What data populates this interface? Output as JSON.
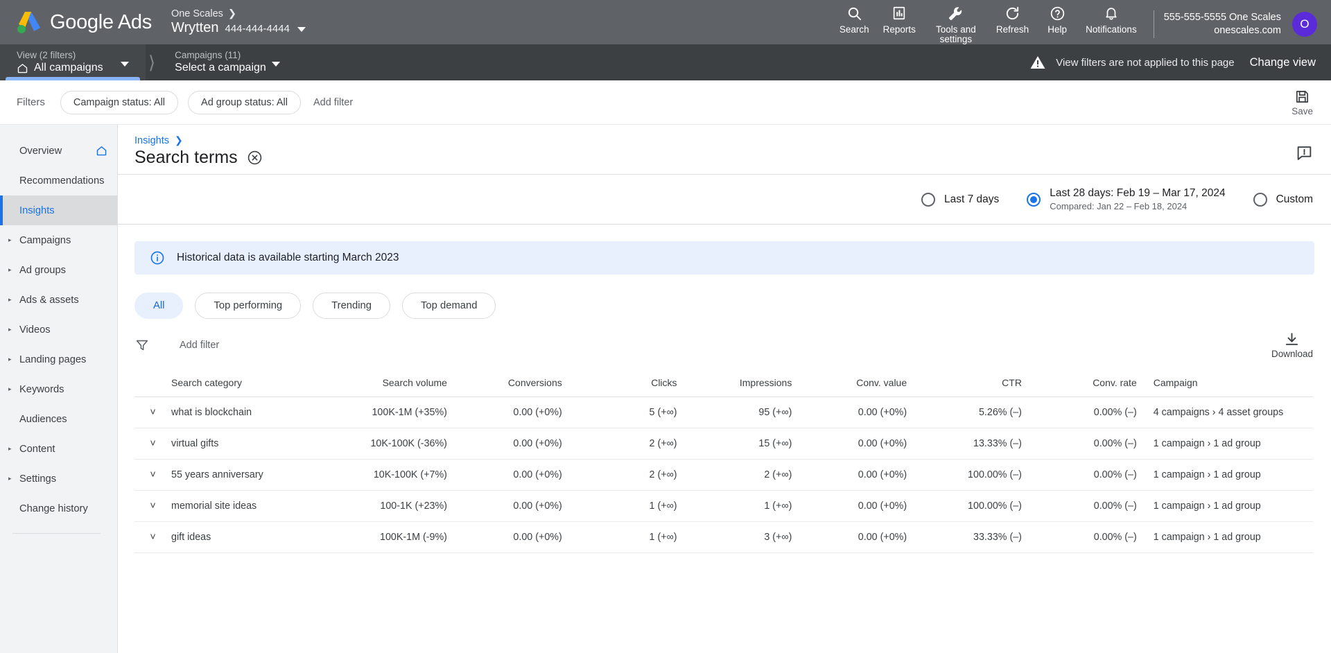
{
  "header": {
    "brand": "Google Ads",
    "manager_account": "One Scales",
    "account_name": "Wrytten",
    "account_id": "444-444-4444",
    "actions": [
      {
        "label": "Search",
        "icon": "search-icon"
      },
      {
        "label": "Reports",
        "icon": "reports-icon"
      },
      {
        "label": "Tools and settings",
        "icon": "wrench-icon"
      },
      {
        "label": "Refresh",
        "icon": "refresh-icon"
      },
      {
        "label": "Help",
        "icon": "help-icon"
      },
      {
        "label": "Notifications",
        "icon": "bell-icon"
      }
    ],
    "account_phone": "555-555-5555 One Scales",
    "account_domain": "onescales.com",
    "avatar_initial": "O"
  },
  "viewbar": {
    "view_caption": "View (2 filters)",
    "view_value": "All campaigns",
    "campaigns_caption": "Campaigns (11)",
    "campaigns_value": "Select a campaign",
    "warning": "View filters are not applied to this page",
    "change_view": "Change view"
  },
  "filterbar": {
    "label": "Filters",
    "chips": [
      "Campaign status: All",
      "Ad group status: All"
    ],
    "add_filter": "Add filter",
    "save_label": "Save"
  },
  "sidebar": {
    "items": [
      {
        "label": "Overview",
        "expandable": false,
        "selected": false,
        "trailing_icon": "home-icon"
      },
      {
        "label": "Recommendations",
        "expandable": false,
        "selected": false
      },
      {
        "label": "Insights",
        "expandable": false,
        "selected": true
      },
      {
        "label": "Campaigns",
        "expandable": true,
        "selected": false
      },
      {
        "label": "Ad groups",
        "expandable": true,
        "selected": false
      },
      {
        "label": "Ads & assets",
        "expandable": true,
        "selected": false
      },
      {
        "label": "Videos",
        "expandable": true,
        "selected": false
      },
      {
        "label": "Landing pages",
        "expandable": true,
        "selected": false
      },
      {
        "label": "Keywords",
        "expandable": true,
        "selected": false
      },
      {
        "label": "Audiences",
        "expandable": false,
        "selected": false
      },
      {
        "label": "Content",
        "expandable": true,
        "selected": false
      },
      {
        "label": "Settings",
        "expandable": true,
        "selected": false
      },
      {
        "label": "Change history",
        "expandable": false,
        "selected": false
      }
    ]
  },
  "page": {
    "breadcrumb": "Insights",
    "title": "Search terms"
  },
  "date_range": {
    "option_last7": "Last 7 days",
    "option_last28": "Last 28 days: Feb 19 – Mar 17, 2024",
    "option_last28_compare": "Compared: Jan 22 – Feb 18, 2024",
    "option_custom": "Custom",
    "selected": "last28"
  },
  "banner": {
    "text": "Historical data is available starting March 2023"
  },
  "pills": [
    {
      "label": "All",
      "active": true
    },
    {
      "label": "Top performing",
      "active": false
    },
    {
      "label": "Trending",
      "active": false
    },
    {
      "label": "Top demand",
      "active": false
    }
  ],
  "table_filter": {
    "add_filter": "Add filter",
    "download_label": "Download"
  },
  "table": {
    "columns": [
      "Search category",
      "Search volume",
      "Conversions",
      "Clicks",
      "Impressions",
      "Conv. value",
      "CTR",
      "Conv. rate",
      "Campaign"
    ],
    "rows": [
      {
        "category": "what is blockchain",
        "search_volume": "100K-1M (+35%)",
        "conversions": "0.00 (+0%)",
        "clicks": "5 (+∞)",
        "impressions": "95 (+∞)",
        "conv_value": "0.00 (+0%)",
        "ctr": "5.26% (–)",
        "conv_rate": "0.00% (–)",
        "campaign": "4 campaigns › 4 asset groups"
      },
      {
        "category": "virtual gifts",
        "search_volume": "10K-100K (-36%)",
        "conversions": "0.00 (+0%)",
        "clicks": "2 (+∞)",
        "impressions": "15 (+∞)",
        "conv_value": "0.00 (+0%)",
        "ctr": "13.33% (–)",
        "conv_rate": "0.00% (–)",
        "campaign": "1 campaign › 1 ad group"
      },
      {
        "category": "55 years anniversary",
        "search_volume": "10K-100K (+7%)",
        "conversions": "0.00 (+0%)",
        "clicks": "2 (+∞)",
        "impressions": "2 (+∞)",
        "conv_value": "0.00 (+0%)",
        "ctr": "100.00% (–)",
        "conv_rate": "0.00% (–)",
        "campaign": "1 campaign › 1 ad group"
      },
      {
        "category": "memorial site ideas",
        "search_volume": "100-1K (+23%)",
        "conversions": "0.00 (+0%)",
        "clicks": "1 (+∞)",
        "impressions": "1 (+∞)",
        "conv_value": "0.00 (+0%)",
        "ctr": "100.00% (–)",
        "conv_rate": "0.00% (–)",
        "campaign": "1 campaign › 1 ad group"
      },
      {
        "category": "gift ideas",
        "search_volume": "100K-1M (-9%)",
        "conversions": "0.00 (+0%)",
        "clicks": "1 (+∞)",
        "impressions": "3 (+∞)",
        "conv_value": "0.00 (+0%)",
        "ctr": "33.33% (–)",
        "conv_rate": "0.00% (–)",
        "campaign": "1 campaign › 1 ad group"
      }
    ]
  },
  "colors": {
    "header_bg": "#5f6368",
    "viewbar_bg": "#3c4043",
    "accent_blue": "#1a73e8",
    "banner_bg": "#e8f0fe",
    "sidebar_bg": "#f1f3f4",
    "avatar_bg": "#5b2bd9"
  }
}
